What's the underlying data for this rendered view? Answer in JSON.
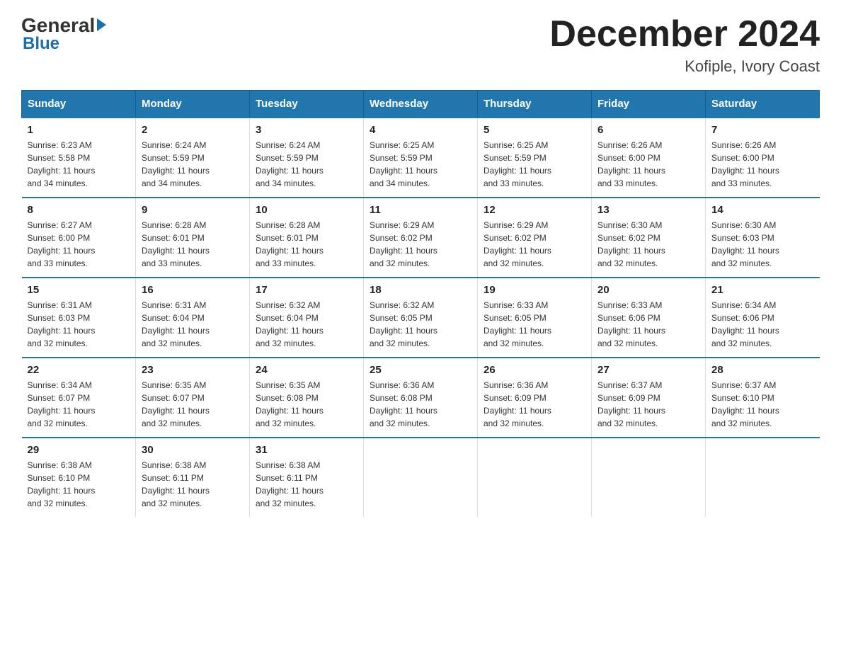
{
  "logo": {
    "brand": "General",
    "triangle": "▶",
    "subtitle": "Blue"
  },
  "header": {
    "month_title": "December 2024",
    "location": "Kofiple, Ivory Coast"
  },
  "days_of_week": [
    "Sunday",
    "Monday",
    "Tuesday",
    "Wednesday",
    "Thursday",
    "Friday",
    "Saturday"
  ],
  "weeks": [
    [
      {
        "num": "1",
        "info": "Sunrise: 6:23 AM\nSunset: 5:58 PM\nDaylight: 11 hours\nand 34 minutes."
      },
      {
        "num": "2",
        "info": "Sunrise: 6:24 AM\nSunset: 5:59 PM\nDaylight: 11 hours\nand 34 minutes."
      },
      {
        "num": "3",
        "info": "Sunrise: 6:24 AM\nSunset: 5:59 PM\nDaylight: 11 hours\nand 34 minutes."
      },
      {
        "num": "4",
        "info": "Sunrise: 6:25 AM\nSunset: 5:59 PM\nDaylight: 11 hours\nand 34 minutes."
      },
      {
        "num": "5",
        "info": "Sunrise: 6:25 AM\nSunset: 5:59 PM\nDaylight: 11 hours\nand 33 minutes."
      },
      {
        "num": "6",
        "info": "Sunrise: 6:26 AM\nSunset: 6:00 PM\nDaylight: 11 hours\nand 33 minutes."
      },
      {
        "num": "7",
        "info": "Sunrise: 6:26 AM\nSunset: 6:00 PM\nDaylight: 11 hours\nand 33 minutes."
      }
    ],
    [
      {
        "num": "8",
        "info": "Sunrise: 6:27 AM\nSunset: 6:00 PM\nDaylight: 11 hours\nand 33 minutes."
      },
      {
        "num": "9",
        "info": "Sunrise: 6:28 AM\nSunset: 6:01 PM\nDaylight: 11 hours\nand 33 minutes."
      },
      {
        "num": "10",
        "info": "Sunrise: 6:28 AM\nSunset: 6:01 PM\nDaylight: 11 hours\nand 33 minutes."
      },
      {
        "num": "11",
        "info": "Sunrise: 6:29 AM\nSunset: 6:02 PM\nDaylight: 11 hours\nand 32 minutes."
      },
      {
        "num": "12",
        "info": "Sunrise: 6:29 AM\nSunset: 6:02 PM\nDaylight: 11 hours\nand 32 minutes."
      },
      {
        "num": "13",
        "info": "Sunrise: 6:30 AM\nSunset: 6:02 PM\nDaylight: 11 hours\nand 32 minutes."
      },
      {
        "num": "14",
        "info": "Sunrise: 6:30 AM\nSunset: 6:03 PM\nDaylight: 11 hours\nand 32 minutes."
      }
    ],
    [
      {
        "num": "15",
        "info": "Sunrise: 6:31 AM\nSunset: 6:03 PM\nDaylight: 11 hours\nand 32 minutes."
      },
      {
        "num": "16",
        "info": "Sunrise: 6:31 AM\nSunset: 6:04 PM\nDaylight: 11 hours\nand 32 minutes."
      },
      {
        "num": "17",
        "info": "Sunrise: 6:32 AM\nSunset: 6:04 PM\nDaylight: 11 hours\nand 32 minutes."
      },
      {
        "num": "18",
        "info": "Sunrise: 6:32 AM\nSunset: 6:05 PM\nDaylight: 11 hours\nand 32 minutes."
      },
      {
        "num": "19",
        "info": "Sunrise: 6:33 AM\nSunset: 6:05 PM\nDaylight: 11 hours\nand 32 minutes."
      },
      {
        "num": "20",
        "info": "Sunrise: 6:33 AM\nSunset: 6:06 PM\nDaylight: 11 hours\nand 32 minutes."
      },
      {
        "num": "21",
        "info": "Sunrise: 6:34 AM\nSunset: 6:06 PM\nDaylight: 11 hours\nand 32 minutes."
      }
    ],
    [
      {
        "num": "22",
        "info": "Sunrise: 6:34 AM\nSunset: 6:07 PM\nDaylight: 11 hours\nand 32 minutes."
      },
      {
        "num": "23",
        "info": "Sunrise: 6:35 AM\nSunset: 6:07 PM\nDaylight: 11 hours\nand 32 minutes."
      },
      {
        "num": "24",
        "info": "Sunrise: 6:35 AM\nSunset: 6:08 PM\nDaylight: 11 hours\nand 32 minutes."
      },
      {
        "num": "25",
        "info": "Sunrise: 6:36 AM\nSunset: 6:08 PM\nDaylight: 11 hours\nand 32 minutes."
      },
      {
        "num": "26",
        "info": "Sunrise: 6:36 AM\nSunset: 6:09 PM\nDaylight: 11 hours\nand 32 minutes."
      },
      {
        "num": "27",
        "info": "Sunrise: 6:37 AM\nSunset: 6:09 PM\nDaylight: 11 hours\nand 32 minutes."
      },
      {
        "num": "28",
        "info": "Sunrise: 6:37 AM\nSunset: 6:10 PM\nDaylight: 11 hours\nand 32 minutes."
      }
    ],
    [
      {
        "num": "29",
        "info": "Sunrise: 6:38 AM\nSunset: 6:10 PM\nDaylight: 11 hours\nand 32 minutes."
      },
      {
        "num": "30",
        "info": "Sunrise: 6:38 AM\nSunset: 6:11 PM\nDaylight: 11 hours\nand 32 minutes."
      },
      {
        "num": "31",
        "info": "Sunrise: 6:38 AM\nSunset: 6:11 PM\nDaylight: 11 hours\nand 32 minutes."
      },
      {
        "num": "",
        "info": ""
      },
      {
        "num": "",
        "info": ""
      },
      {
        "num": "",
        "info": ""
      },
      {
        "num": "",
        "info": ""
      }
    ]
  ]
}
